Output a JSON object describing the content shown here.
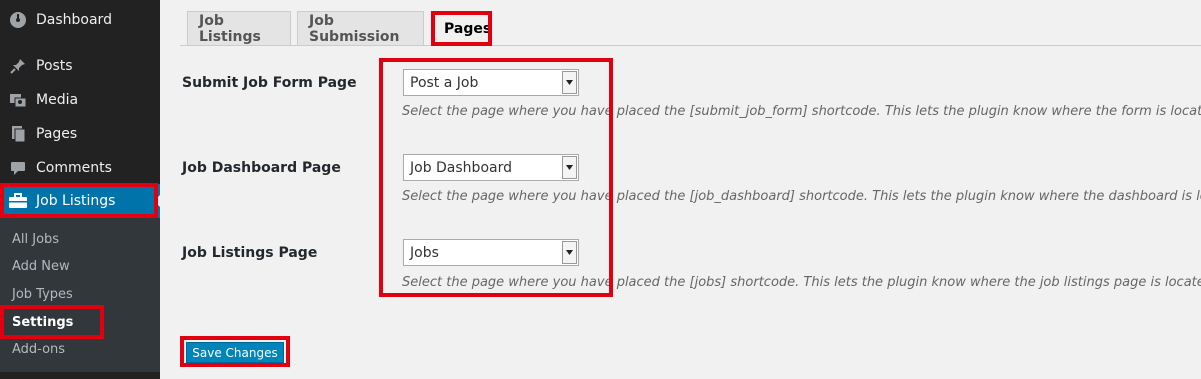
{
  "sidebar": {
    "items": [
      {
        "label": "Dashboard",
        "icon": "dashboard-icon"
      },
      {
        "label": "Posts",
        "icon": "pin-icon"
      },
      {
        "label": "Media",
        "icon": "media-icon"
      },
      {
        "label": "Pages",
        "icon": "pages-icon"
      },
      {
        "label": "Comments",
        "icon": "comment-icon"
      },
      {
        "label": "Job Listings",
        "icon": "briefcase-icon"
      }
    ],
    "submenu": [
      "All Jobs",
      "Add New",
      "Job Types",
      "Settings",
      "Add-ons"
    ]
  },
  "tabs": [
    "Job Listings",
    "Job Submission",
    "Pages"
  ],
  "settings": [
    {
      "label": "Submit Job Form Page",
      "value": "Post a Job",
      "description": "Select the page where you have placed the [submit_job_form] shortcode. This lets the plugin know where the form is located."
    },
    {
      "label": "Job Dashboard Page",
      "value": "Job Dashboard",
      "description": "Select the page where you have placed the [job_dashboard] shortcode. This lets the plugin know where the dashboard is located."
    },
    {
      "label": "Job Listings Page",
      "value": "Jobs",
      "description": "Select the page where you have placed the [jobs] shortcode. This lets the plugin know where the job listings page is located."
    }
  ],
  "save_label": "Save Changes",
  "colors": {
    "highlight": "#e0000f",
    "accent": "#0073aa",
    "sidebar": "#222222"
  }
}
